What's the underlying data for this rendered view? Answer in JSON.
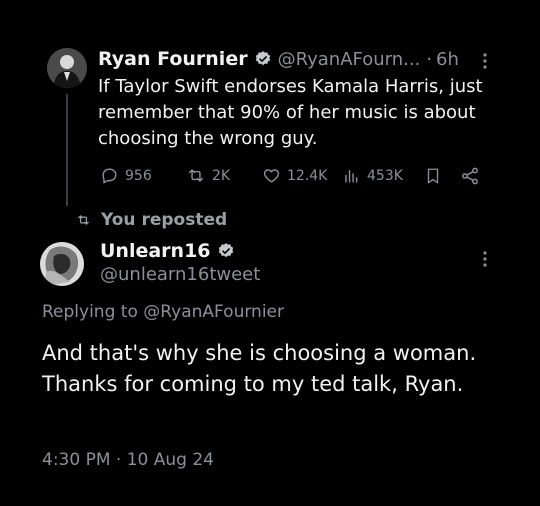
{
  "original_tweet": {
    "author_name": "Ryan Fournier",
    "handle": "@RyanAFourn...",
    "separator": "·",
    "time": "6h",
    "text": "If Taylor Swift endorses Kamala Harris, just remember that 90% of her music is about choosing the wrong guy.",
    "actions": {
      "replies": "956",
      "reposts": "2K",
      "likes": "12.4K",
      "views": "453K"
    }
  },
  "repost_banner": {
    "label": "You reposted"
  },
  "reply_tweet": {
    "author_name": "Unlearn16",
    "handle": "@unlearn16tweet",
    "replying_to": "Replying to @RyanAFournier",
    "text": "And that's why she is choosing a woman.  Thanks for coming to my ted talk, Ryan.",
    "timestamp": "4:30 PM · 10 Aug 24"
  },
  "colors": {
    "background": "#000000",
    "text": "#e7e9ea",
    "muted": "#8b9096",
    "verified_badge": "#c7c9cc"
  },
  "icons": [
    "verified-badge-icon",
    "more-icon",
    "reply-icon",
    "repost-icon",
    "like-icon",
    "views-icon",
    "bookmark-icon",
    "share-icon"
  ]
}
